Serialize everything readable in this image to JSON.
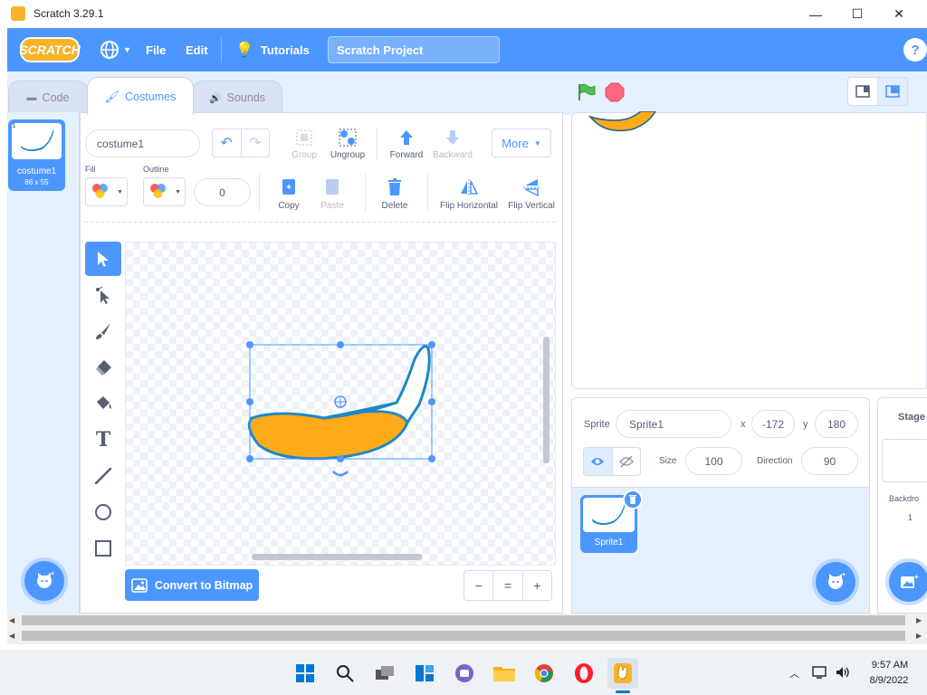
{
  "window": {
    "title": "Scratch 3.29.1",
    "minimize": "—",
    "maximize": "☐",
    "close": "✕"
  },
  "menubar": {
    "logo": "SCRATCH",
    "file": "File",
    "edit": "Edit",
    "tutorials": "Tutorials",
    "project_title": "Scratch Project",
    "help": "?"
  },
  "tabs": [
    {
      "label": "Code",
      "active": false
    },
    {
      "label": "Costumes",
      "active": true
    },
    {
      "label": "Sounds",
      "active": false
    }
  ],
  "costume_list": [
    {
      "index": "1",
      "name": "costume1",
      "size": "86 x 55"
    }
  ],
  "editor": {
    "costume_name": "costume1",
    "fill_label": "Fill",
    "outline_label": "Outline",
    "outline_width": "0",
    "group": "Group",
    "ungroup": "Ungroup",
    "forward": "Forward",
    "backward": "Backward",
    "more": "More",
    "copy": "Copy",
    "paste": "Paste",
    "delete": "Delete",
    "flip_horizontal": "Flip Horizontal",
    "flip_vertical": "Flip Vertical",
    "convert": "Convert to Bitmap",
    "zoom_out": "−",
    "zoom_reset": "=",
    "zoom_in": "+"
  },
  "sprite_info": {
    "sprite_label": "Sprite",
    "sprite_name": "Sprite1",
    "x_label": "x",
    "x_value": "-172",
    "y_label": "y",
    "y_value": "180",
    "size_label": "Size",
    "size_value": "100",
    "direction_label": "Direction",
    "direction_value": "90"
  },
  "sprites": [
    {
      "name": "Sprite1",
      "selected": true
    }
  ],
  "stage_pane": {
    "title": "Stage",
    "backdrops_label": "Backdro",
    "backdrop_count": "1"
  },
  "taskbar": {
    "time": "9:57 AM",
    "date": "8/9/2022"
  },
  "colors": {
    "accent": "#4c97ff",
    "banana": "#ffab1a",
    "outline": "#1e88c8"
  }
}
